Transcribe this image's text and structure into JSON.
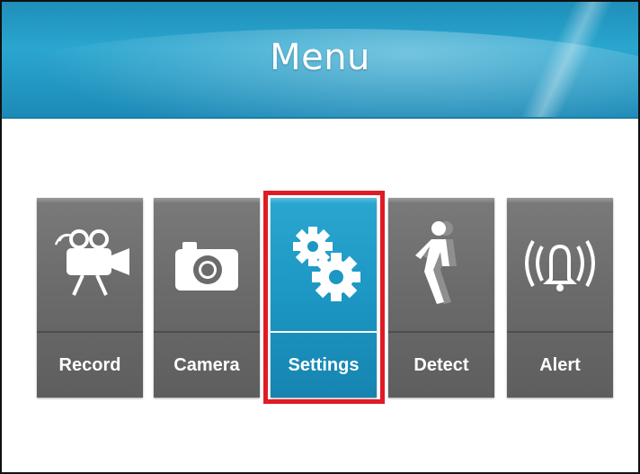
{
  "header": {
    "title": "Menu"
  },
  "menu": {
    "items": [
      {
        "id": "record",
        "label": "Record",
        "icon": "video-camera-icon"
      },
      {
        "id": "camera",
        "label": "Camera",
        "icon": "camera-icon"
      },
      {
        "id": "settings",
        "label": "Settings",
        "icon": "gears-icon",
        "selected": true
      },
      {
        "id": "detect",
        "label": "Detect",
        "icon": "walking-person-icon"
      },
      {
        "id": "alert",
        "label": "Alert",
        "icon": "ringing-bell-icon"
      }
    ]
  },
  "colors": {
    "header": "#2aa6cf",
    "tile": "#6b6b6b",
    "tile_selected": "#1c96c3",
    "highlight_border": "#e01b24"
  }
}
